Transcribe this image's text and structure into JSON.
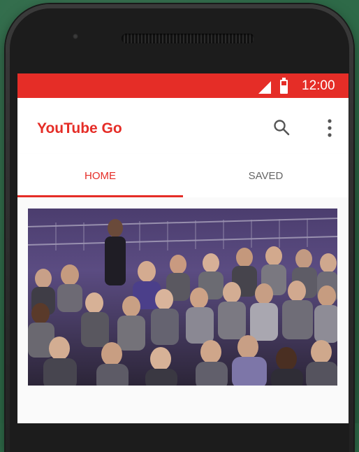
{
  "status_bar": {
    "time": "12:00"
  },
  "app_bar": {
    "title": "YouTube Go"
  },
  "tabs": [
    {
      "label": "HOME",
      "active": true
    },
    {
      "label": "SAVED",
      "active": false
    }
  ],
  "colors": {
    "accent": "#e52d27"
  },
  "icons": [
    "signal-icon",
    "battery-icon",
    "search-icon",
    "more-vert-icon"
  ]
}
